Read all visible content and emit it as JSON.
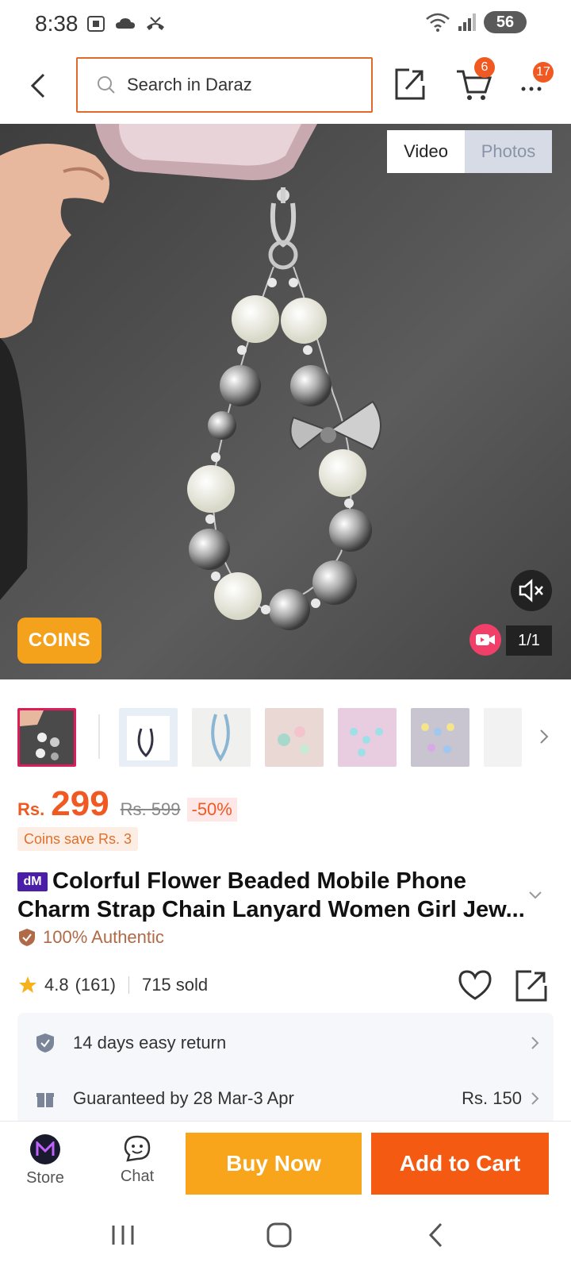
{
  "status_bar": {
    "time": "8:38",
    "battery": "56"
  },
  "nav": {
    "search_placeholder": "Search in Daraz",
    "cart_badge": "6",
    "more_badge": "17"
  },
  "hero": {
    "toggle_video": "Video",
    "toggle_photos": "Photos",
    "coins_label": "COINS",
    "counter": "1/1"
  },
  "price": {
    "currency": "Rs.",
    "current": "299",
    "original": "Rs. 599",
    "discount": "-50%",
    "coins_save": "Coins save Rs. 3"
  },
  "product": {
    "brand_logo": "dM",
    "title": "Colorful Flower Beaded Mobile Phone Charm Strap Chain Lanyard Women Girl Jew...",
    "authentic": "100% Authentic",
    "rating": "4.8",
    "reviews": "(161)",
    "sold": "715 sold"
  },
  "info": {
    "return_text": "14 days easy return",
    "delivery_text": "Guaranteed by 28 Mar-3 Apr",
    "delivery_fee": "Rs. 150"
  },
  "actions": {
    "store_label": "Store",
    "chat_label": "Chat",
    "buy_now": "Buy Now",
    "add_to_cart": "Add to Cart"
  },
  "colors": {
    "accent_orange": "#f05a22",
    "buy_now_bg": "#f8a51c",
    "add_cart_bg": "#f55a12",
    "coins_bg": "#f4a11b"
  }
}
